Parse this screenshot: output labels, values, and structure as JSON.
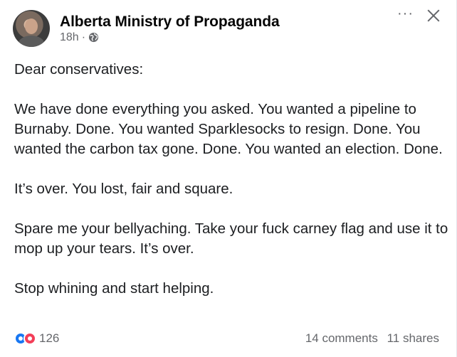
{
  "post": {
    "page_name": "Alberta Ministry of Propaganda",
    "time": "18h",
    "separator": "·",
    "privacy_icon": "globe-icon",
    "more_icon": "more-options-icon",
    "more_label": "···",
    "close_icon": "close-icon",
    "paragraphs": [
      "Dear conservatives:",
      "We have done everything you asked. You wanted a pipeline to Burnaby. Done. You wanted Sparklesocks to resign. Done. You wanted the carbon tax gone. Done. You wanted an election. Done.",
      "It’s over. You lost, fair and square.",
      "Spare me your bellyaching. Take your fuck carney flag and use it to mop up your tears. It’s over.",
      "Stop whining and start helping."
    ],
    "reactions": {
      "icons": [
        "like-icon",
        "love-icon"
      ],
      "count": "126",
      "like_color": "#1877f2",
      "love_color": "#f33e58"
    },
    "comments": "14 comments",
    "shares": "11 shares"
  }
}
